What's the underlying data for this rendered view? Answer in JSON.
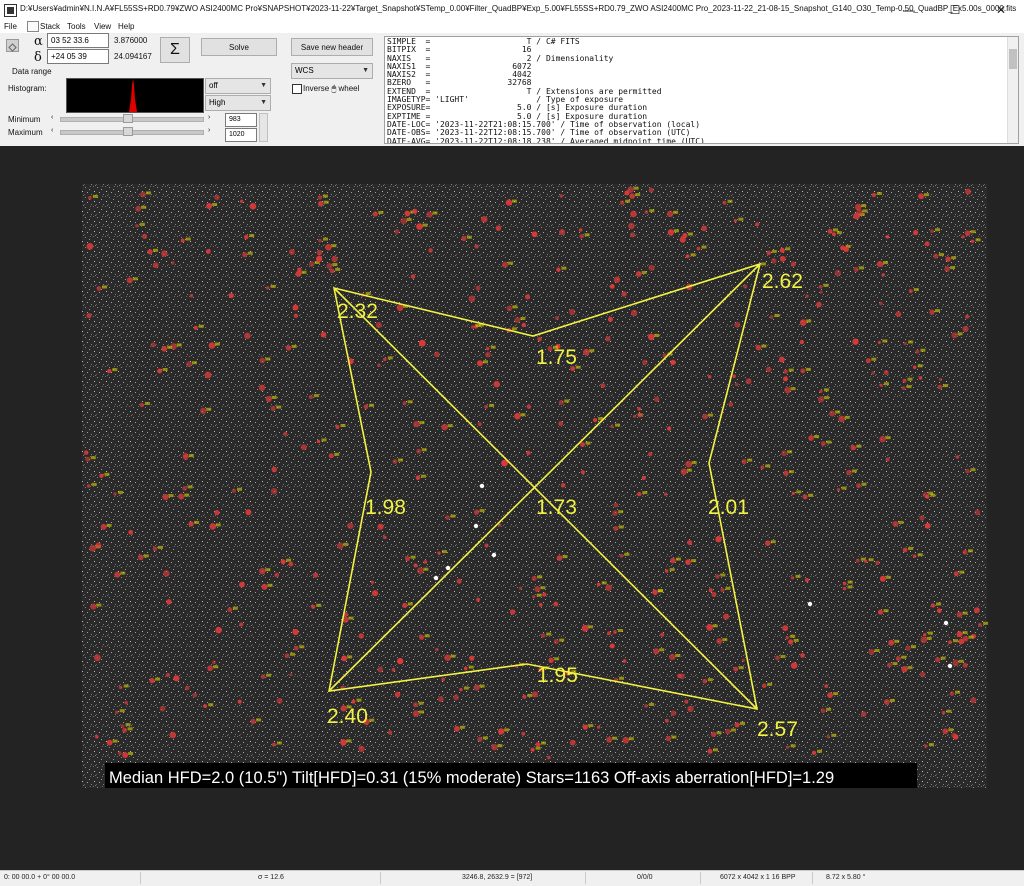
{
  "window": {
    "title": "D:¥Users¥admin¥N.I.N.A¥FL55SS+RD0.79¥ZWO ASI2400MC Pro¥SNAPSHOT¥2023-11-22¥Target_Snapshot¥STemp_0.00¥Filter_QuadBP¥Exp_5.00¥FL55SS+RD0.79_ZWO ASI2400MC Pro_2023-11-22_21-08-15_Snapshot_G140_O30_Temp-0.50_QuadBP_Ex5.00s_0000.fits",
    "minimize": "—",
    "maximize": "☐",
    "close": "✕"
  },
  "menu": [
    "File",
    "Stack",
    "Tools",
    "View",
    "Help"
  ],
  "coords": {
    "alpha_symbol": "α",
    "delta_symbol": "δ",
    "ra_input": "03 52 33.6",
    "ra_value": "3.876000",
    "dec_input": "+24 05 39",
    "dec_value": "24.094167"
  },
  "buttons": {
    "sigma": "Σ",
    "solve": "Solve",
    "save_header": "Save new header"
  },
  "projection": {
    "selected": "WCS"
  },
  "inverse_wheel": {
    "label": "Inverse 🖱 wheel",
    "checked": false
  },
  "data_range": {
    "label": "Data range",
    "histogram_label": "Histogram:",
    "mode1": "off",
    "mode2": "High",
    "minimum_label": "Minimum",
    "maximum_label": "Maximum",
    "minimum_value": "983",
    "maximum_value": "1020",
    "minimum_level": 0.48,
    "maximum_level": 0.48
  },
  "header_text": "SIMPLE  =                    T / C# FITS\nBITPIX  =                   16\nNAXIS   =                    2 / Dimensionality\nNAXIS1  =                 6072\nNAXIS2  =                 4042\nBZERO   =                32768\nEXTEND  =                    T / Extensions are permitted\nIMAGETYP= 'LIGHT'              / Type of exposure\nEXPOSURE=                  5.0 / [s] Exposure duration\nEXPTIME =                  5.0 / [s] Exposure duration\nDATE-LOC= '2023-11-22T21:08:15.700' / Time of observation (local)\nDATE-OBS= '2023-11-22T12:08:15.700' / Time of observation (UTC)\nDATE-AVG= '2023-11-22T12:08:18.238' / Averaged midpoint time (UTC)",
  "inspector": {
    "corners": {
      "top_left": "2.32",
      "top_right": "2.62",
      "bottom_left": "2.40",
      "bottom_right": "2.57"
    },
    "edges": {
      "top": "1.75",
      "left": "1.98",
      "right": "2.01",
      "bottom": "1.95",
      "center": "1.73"
    },
    "summary": "Median HFD=2.0 (10.5\")  Tilt[HFD]=0.31 (15% moderate)  Stars=1163  Off-axis aberration[HFD]=1.29",
    "overlay_color": "#f2f244",
    "star_mark_color": "#e23a3a",
    "star_label_color": "#d8d000"
  },
  "status": {
    "coords": "0: 00  00.0   + 0° 00  00.0",
    "sigma": "σ = 12.6",
    "pixel": "3246.8, 2632.9 = [972]",
    "count": "0/0/0",
    "dimensions": "6072 x 4042 x 1  16 BPP",
    "fov": "8.72 x 5.80 °"
  }
}
